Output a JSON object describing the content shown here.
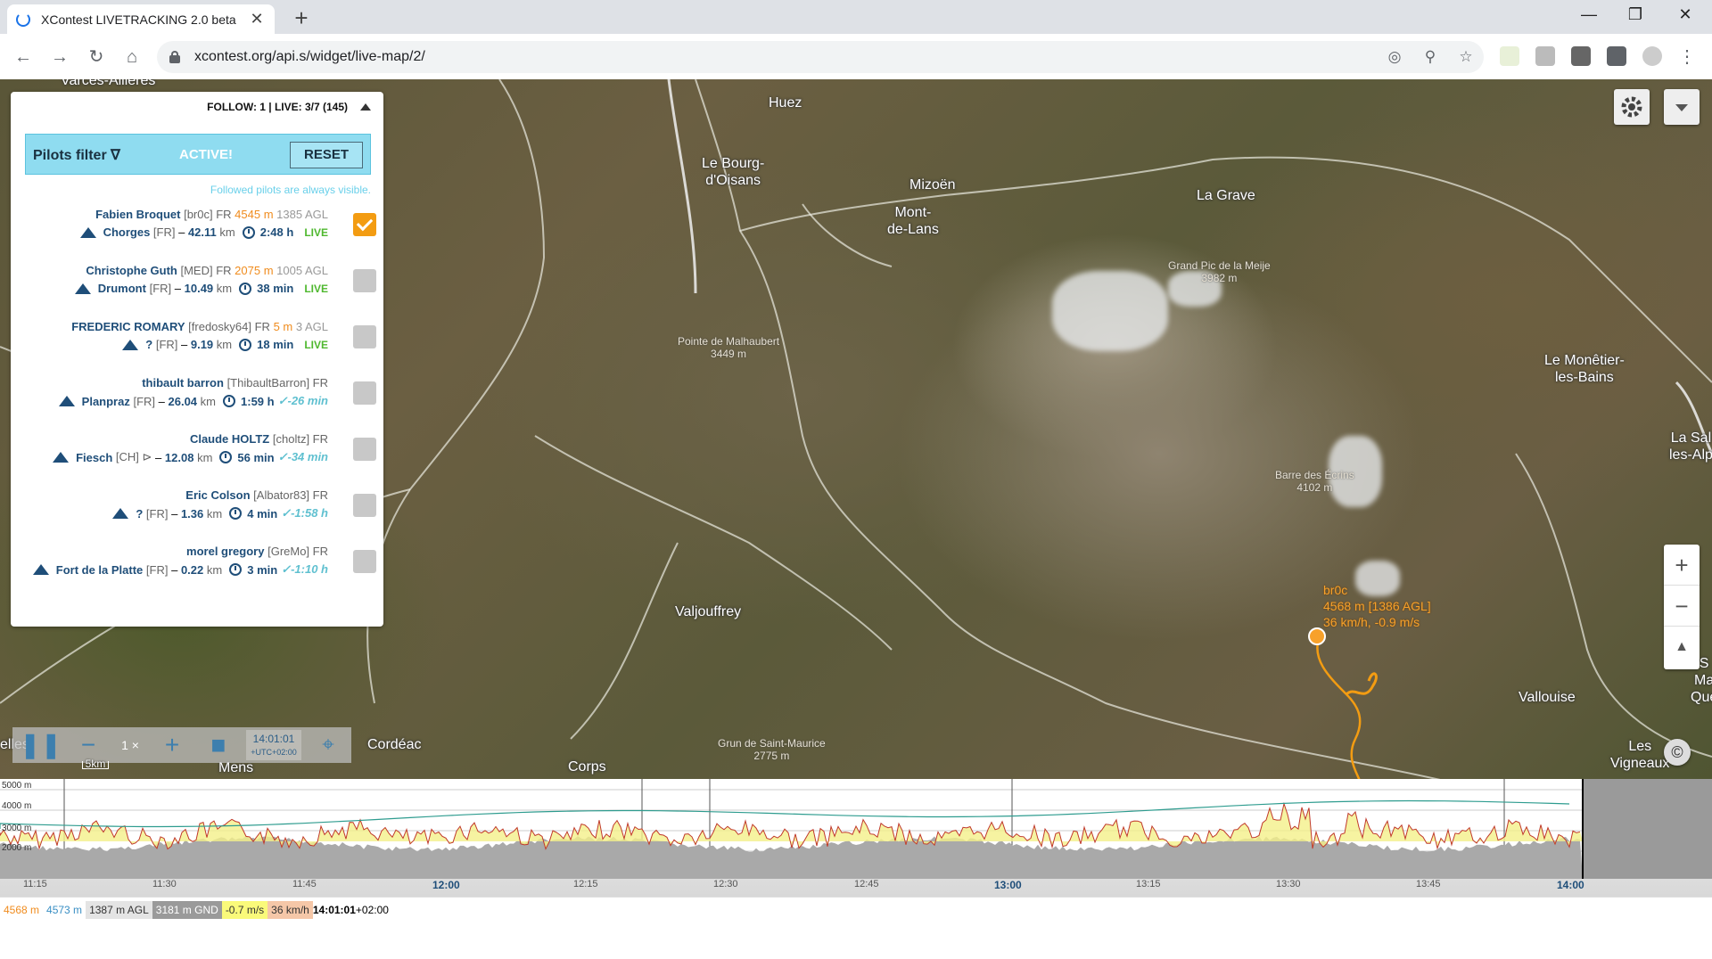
{
  "browser": {
    "tab_title": "XContest LIVETRACKING 2.0 beta",
    "url": "xcontest.org/api.s/widget/live-map/2/"
  },
  "panel": {
    "header": "FOLLOW: 1 | LIVE: 3/7 (145)",
    "filter_label": "Pilots filter ∇",
    "filter_status": "ACTIVE!",
    "reset_label": "RESET",
    "note": "Followed pilots are always visible."
  },
  "pilots": [
    {
      "name": "Fabien Broquet",
      "id": "[br0c] FR",
      "alt": "4545 m",
      "agl": "1385 AGL",
      "launch": "Chorges",
      "cc": "[FR]",
      "dist": "42.11",
      "time": "2:48 h",
      "status": "LIVE",
      "followed": true
    },
    {
      "name": "Christophe Guth",
      "id": "[MED] FR",
      "alt": "2075 m",
      "agl": "1005 AGL",
      "launch": "Drumont",
      "cc": "[FR]",
      "dist": "10.49",
      "time": "38 min",
      "status": "LIVE",
      "followed": false
    },
    {
      "name": "FREDERIC ROMARY",
      "id": "[fredosky64] FR",
      "alt": "5 m",
      "agl": "3 AGL",
      "launch": "?",
      "cc": "[FR]",
      "dist": "9.19",
      "time": "18 min",
      "status": "LIVE",
      "followed": false
    },
    {
      "name": "thibault barron",
      "id": "[ThibaultBarron] FR",
      "alt": "",
      "agl": "",
      "launch": "Planpraz",
      "cc": "[FR]",
      "dist": "26.04",
      "time": "1:59 h",
      "status": "✓-26 min",
      "followed": false
    },
    {
      "name": "Claude HOLTZ",
      "id": "[choltz] FR",
      "alt": "",
      "agl": "",
      "launch": "Fiesch",
      "cc": "[CH] ⊳",
      "dist": "12.08",
      "time": "56 min",
      "status": "✓-34 min",
      "followed": false
    },
    {
      "name": "Eric Colson",
      "id": "[Albator83] FR",
      "alt": "",
      "agl": "",
      "launch": "?",
      "cc": "[FR]",
      "dist": "1.36",
      "time": "4 min",
      "status": "✓-1:58 h",
      "followed": false
    },
    {
      "name": "morel gregory",
      "id": "[GreMo] FR",
      "alt": "",
      "agl": "",
      "launch": "Fort de la Platte",
      "cc": "[FR]",
      "dist": "0.22",
      "time": "3 min",
      "status": "✓-1:10 h",
      "followed": false
    }
  ],
  "dist_unit": "km",
  "places": {
    "p0": "Varces-Allières",
    "p1": "Huez",
    "p2": "Le Bourg-\nd'Oisans",
    "p3": "Mizoën",
    "p4": "Mont-\nde-Lans",
    "p5": "La Grave",
    "p6": "Le Monêtier-\nles-Bains",
    "p7": "La Sal\nles-Alp",
    "p8": "Valjouffrey",
    "p9": "Vallouise",
    "p10": "Cordéac",
    "p11": "Mens",
    "p12": "Corps",
    "p13": "Les\nVigneaux",
    "p14": "S\nMa\nQue",
    "p15": "elles"
  },
  "peaks": {
    "k1": "Grand Pic de la Meije\n3982 m",
    "k2": "Pointe de Malhaubert\n3449 m",
    "k3": "Barre des Écrins\n4102 m",
    "k4": "Grun de Saint-Maurice\n2775 m"
  },
  "track_label": {
    "id": "br0c",
    "line1": "4568 m [1386 AGL]",
    "line2": "36 km/h, -0.9 m/s"
  },
  "player": {
    "speed": "1 ×",
    "time": "14:01:01",
    "tz": "+UTC+02:00",
    "scale": "5km"
  },
  "chart_axes": {
    "y": [
      "5000 m",
      "4000 m",
      "3000 m",
      "2000 m"
    ],
    "x": [
      "11:15",
      "11:30",
      "11:45",
      "12:00",
      "12:15",
      "12:30",
      "12:45",
      "13:00",
      "13:15",
      "13:30",
      "13:45",
      "14:00"
    ]
  },
  "status_bar": {
    "alt_gps": "4568 m",
    "alt_baro": "4573 m",
    "agl": "1387 m AGL",
    "gnd": "3181 m GND",
    "vario": "-0.7 m/s",
    "speed": "36 km/h",
    "time": "14:01:01",
    "tz": "+02:00"
  },
  "colors": {
    "accent": "#1f4e79",
    "altitude": "#f08c1e",
    "live": "#4fb82f",
    "filter": "#8fdcf0",
    "track": "#f7a12b"
  }
}
